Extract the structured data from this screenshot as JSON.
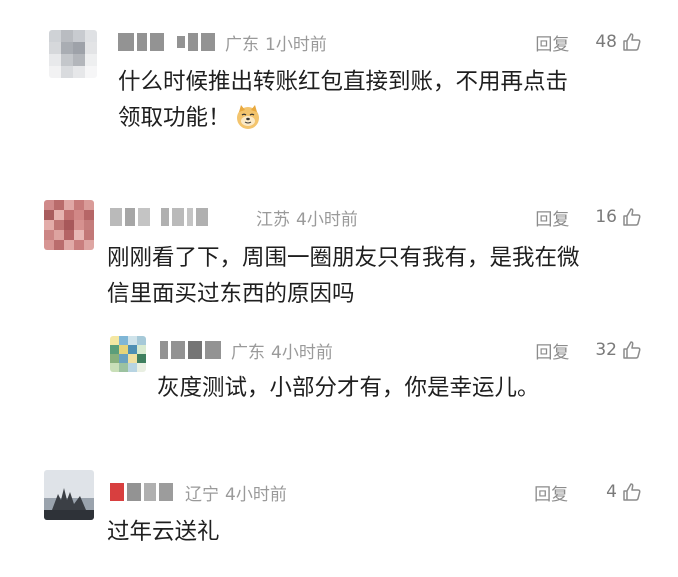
{
  "comments": [
    {
      "location": "广东",
      "time": "1小时前",
      "reply_label": "回复",
      "likes": "48",
      "text_line1": "什么时候推出转账红包直接到账，不用再点击",
      "text_line2": "领取功能！",
      "emoji": "doge-emoji"
    },
    {
      "location": "江苏",
      "time": "4小时前",
      "reply_label": "回复",
      "likes": "16",
      "text_line1": "刚刚看了下，周围一圈朋友只有我有，是我在微",
      "text_line2": "信里面买过东西的原因吗",
      "reply": {
        "location": "广东",
        "time": "4小时前",
        "reply_label": "回复",
        "likes": "32",
        "text": "灰度测试，小部分才有，你是幸运儿。"
      }
    },
    {
      "location": "辽宁",
      "time": "4小时前",
      "reply_label": "回复",
      "likes": "4",
      "text": "过年云送礼"
    }
  ],
  "colors": {
    "meta_text": "#9a9a9a",
    "body_text": "#1f1f1f",
    "background": "#ffffff"
  }
}
